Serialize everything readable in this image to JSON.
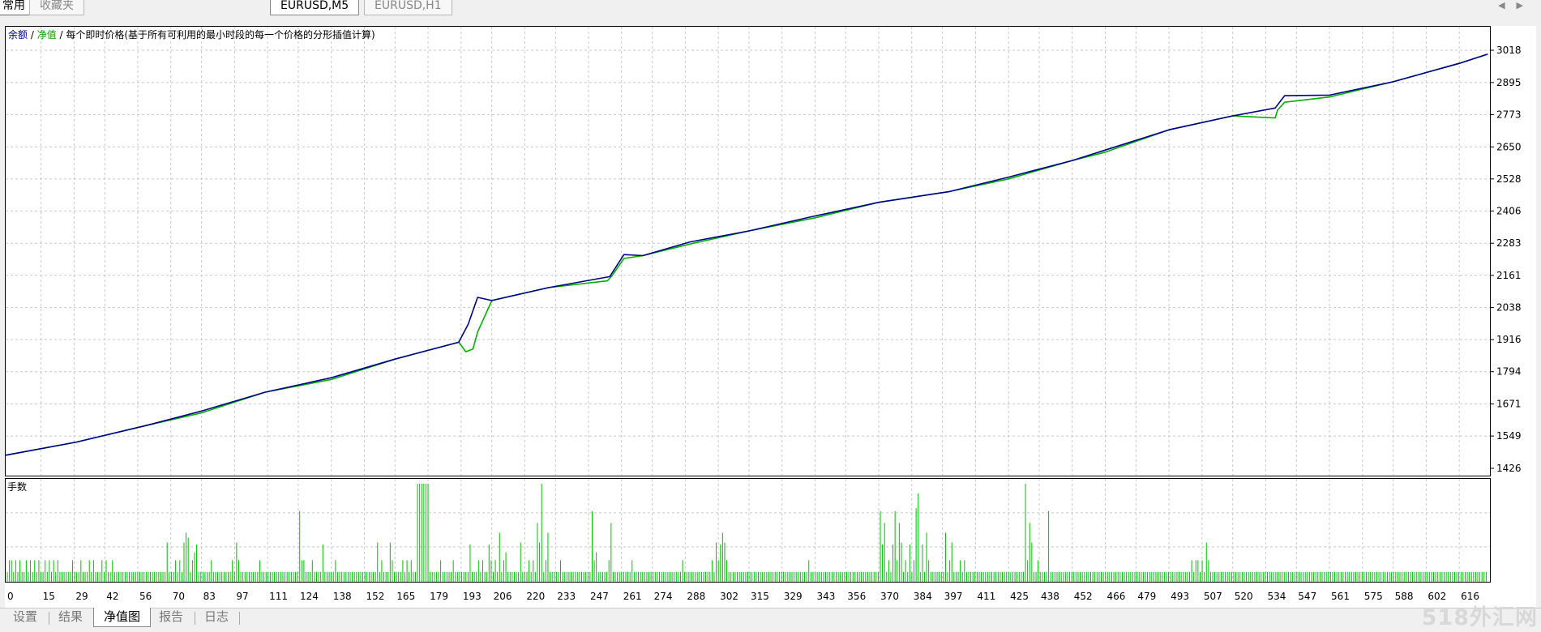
{
  "top_tabs": [
    {
      "label": "常用",
      "active": true
    },
    {
      "label": "收藏夹",
      "active": false
    }
  ],
  "symbol_tabs": [
    {
      "label": "EURUSD,M5",
      "active": true
    },
    {
      "label": "EURUSD,H1",
      "active": false
    }
  ],
  "legend": {
    "balance": "余额",
    "sep1": " / ",
    "equity": "净值",
    "sep2": " / ",
    "desc": "每个即时价格(基于所有可利用的最小时段的每一个价格的分形插值计算)"
  },
  "volume_label": "手数",
  "bottom_tabs": [
    {
      "label": "设置",
      "active": false
    },
    {
      "label": "结果",
      "active": false
    },
    {
      "label": "净值图",
      "active": true
    },
    {
      "label": "报告",
      "active": false
    },
    {
      "label": "日志",
      "active": false
    }
  ],
  "watermark": "518外汇网",
  "chart_data": [
    {
      "type": "line",
      "y_ticks": [
        3018,
        2895,
        2773,
        2650,
        2528,
        2406,
        2283,
        2161,
        2038,
        1916,
        1794,
        1671,
        1549,
        1426
      ],
      "ylim": [
        1426,
        3018
      ],
      "xlim": [
        0,
        629
      ],
      "x_ticks": [
        0,
        15,
        29,
        42,
        56,
        70,
        83,
        97,
        111,
        124,
        138,
        152,
        165,
        179,
        193,
        206,
        220,
        233,
        247,
        261,
        274,
        288,
        302,
        315,
        329,
        343,
        356,
        370,
        384,
        397,
        411,
        425,
        438,
        452,
        466,
        479,
        493,
        507,
        520,
        534,
        547,
        561,
        575,
        588,
        602,
        616
      ],
      "grid": true,
      "series": [
        {
          "name": "余额",
          "color": "#00008b",
          "x": [
            0,
            30,
            60,
            83,
            110,
            138,
            165,
            192,
            196,
            200,
            206,
            230,
            256,
            262,
            270,
            290,
            315,
            343,
            370,
            400,
            425,
            452,
            466,
            493,
            520,
            538,
            542,
            561,
            588,
            616,
            628
          ],
          "y": [
            1476,
            1526,
            1590,
            1644,
            1716,
            1771,
            1842,
            1906,
            1975,
            2077,
            2065,
            2114,
            2156,
            2240,
            2236,
            2288,
            2330,
            2387,
            2439,
            2480,
            2535,
            2598,
            2638,
            2715,
            2768,
            2798,
            2845,
            2847,
            2898,
            2968,
            3003
          ]
        },
        {
          "name": "净值",
          "color": "#00b000",
          "x": [
            0,
            30,
            60,
            83,
            110,
            138,
            165,
            192,
            195,
            198,
            200,
            206,
            230,
            255,
            257,
            262,
            270,
            290,
            315,
            343,
            370,
            400,
            425,
            452,
            466,
            493,
            520,
            538,
            539,
            542,
            561,
            588,
            616,
            628
          ],
          "y": [
            1476,
            1526,
            1590,
            1637,
            1716,
            1764,
            1842,
            1906,
            1870,
            1880,
            1945,
            2065,
            2114,
            2140,
            2160,
            2225,
            2236,
            2280,
            2330,
            2380,
            2439,
            2480,
            2528,
            2598,
            2630,
            2715,
            2768,
            2760,
            2790,
            2820,
            2840,
            2898,
            2968,
            3003
          ]
        }
      ]
    },
    {
      "type": "bar",
      "name": "手数",
      "color": "#00c000",
      "xlim": [
        0,
        629
      ],
      "heights_pct": [
        10,
        22,
        22,
        10,
        22,
        10,
        22,
        10,
        10,
        22,
        10,
        22,
        10,
        22,
        10,
        22,
        10,
        10,
        22,
        10,
        22,
        10,
        22,
        10,
        22,
        10,
        10,
        10,
        10,
        10,
        10,
        22,
        10,
        10,
        10,
        22,
        10,
        10,
        10,
        22,
        10,
        22,
        10,
        10,
        10,
        22,
        10,
        22,
        10,
        10,
        22,
        10,
        10,
        10,
        10,
        10,
        10,
        10,
        10,
        10,
        10,
        10,
        10,
        10,
        10,
        10,
        10,
        10,
        10,
        10,
        10,
        10,
        10,
        10,
        10,
        10,
        40,
        10,
        10,
        10,
        22,
        10,
        22,
        10,
        40,
        50,
        45,
        10,
        22,
        30,
        38,
        10,
        10,
        10,
        10,
        10,
        10,
        22,
        10,
        10,
        10,
        10,
        10,
        10,
        10,
        10,
        10,
        22,
        10,
        40,
        22,
        10,
        10,
        10,
        10,
        10,
        10,
        10,
        10,
        10,
        22,
        10,
        10,
        10,
        10,
        10,
        10,
        10,
        10,
        10,
        10,
        10,
        10,
        10,
        10,
        10,
        10,
        10,
        10,
        72,
        22,
        22,
        10,
        10,
        10,
        22,
        10,
        10,
        10,
        10,
        38,
        10,
        10,
        10,
        10,
        10,
        22,
        10,
        10,
        10,
        10,
        10,
        10,
        10,
        10,
        10,
        10,
        10,
        10,
        10,
        10,
        10,
        10,
        10,
        10,
        10,
        40,
        10,
        22,
        10,
        10,
        10,
        40,
        22,
        10,
        10,
        10,
        10,
        22,
        10,
        22,
        10,
        22,
        10,
        10,
        100,
        100,
        100,
        100,
        100,
        100,
        10,
        10,
        10,
        10,
        10,
        22,
        10,
        10,
        10,
        10,
        10,
        22,
        10,
        10,
        10,
        10,
        10,
        10,
        10,
        38,
        10,
        10,
        10,
        22,
        10,
        22,
        10,
        10,
        38,
        22,
        10,
        22,
        10,
        50,
        10,
        22,
        30,
        10,
        10,
        10,
        10,
        10,
        10,
        40,
        10,
        10,
        10,
        22,
        10,
        22,
        10,
        60,
        40,
        100,
        10,
        22,
        50,
        10,
        10,
        10,
        10,
        10,
        22,
        10,
        10,
        10,
        10,
        10,
        10,
        10,
        10,
        10,
        10,
        10,
        10,
        10,
        10,
        72,
        22,
        30,
        10,
        10,
        10,
        10,
        10,
        22,
        60,
        10,
        10,
        10,
        10,
        10,
        10,
        10,
        10,
        10,
        22,
        10,
        10,
        10,
        10,
        10,
        10,
        10,
        10,
        10,
        10,
        10,
        10,
        10,
        10,
        10,
        10,
        10,
        10,
        10,
        10,
        10,
        10,
        10,
        22,
        10,
        10,
        10,
        10,
        10,
        10,
        10,
        10,
        10,
        10,
        10,
        10,
        10,
        22,
        10,
        40,
        22,
        38,
        50,
        40,
        22,
        10,
        10,
        10,
        10,
        10,
        10,
        10,
        10,
        10,
        10,
        10,
        10,
        10,
        10,
        10,
        10,
        10,
        10,
        10,
        10,
        10,
        10,
        10,
        10,
        10,
        10,
        10,
        10,
        10,
        10,
        10,
        10,
        10,
        10,
        10,
        10,
        10,
        10,
        22,
        10,
        10,
        10,
        10,
        10,
        10,
        10,
        10,
        10,
        10,
        10,
        10,
        10,
        10,
        10,
        10,
        10,
        10,
        10,
        10,
        10,
        10,
        10,
        10,
        10,
        10,
        10,
        10,
        10,
        10,
        10,
        10,
        10,
        72,
        38,
        60,
        10,
        22,
        10,
        38,
        72,
        22,
        60,
        40,
        10,
        22,
        10,
        38,
        10,
        22,
        75,
        90,
        10,
        38,
        10,
        50,
        22,
        10,
        10,
        10,
        10,
        10,
        10,
        10,
        50,
        10,
        22,
        40,
        10,
        10,
        10,
        22,
        10,
        22,
        10,
        10,
        10,
        10,
        10,
        10,
        10,
        10,
        10,
        10,
        10,
        10,
        10,
        10,
        10,
        10,
        10,
        10,
        10,
        10,
        10,
        10,
        10,
        10,
        10,
        10,
        10,
        10,
        100,
        22,
        60,
        40,
        10,
        10,
        22,
        10,
        10,
        10,
        10,
        72,
        10,
        10,
        10,
        10,
        10,
        10,
        10,
        10,
        10,
        10,
        10,
        10,
        10,
        10,
        10,
        10,
        10,
        10,
        10,
        10,
        10,
        10,
        10,
        10,
        10,
        10,
        10,
        10,
        10,
        10,
        10,
        10,
        10,
        10,
        10,
        10,
        10,
        10,
        10,
        10,
        10,
        10,
        10,
        10,
        10,
        10,
        10,
        10,
        10,
        10,
        10,
        10,
        10,
        10,
        10,
        10,
        10,
        10,
        10,
        10,
        10,
        10,
        10,
        10,
        10,
        10,
        10,
        22,
        10,
        22,
        22,
        10,
        22,
        10,
        40,
        22,
        10,
        10,
        10,
        10,
        10,
        10,
        10,
        10,
        10,
        10,
        10,
        10,
        10,
        10,
        10,
        10,
        10,
        10,
        10,
        10,
        10,
        10,
        10,
        10,
        10,
        10,
        10,
        10,
        10,
        10,
        10,
        10,
        10,
        10,
        10,
        10,
        10,
        10,
        10,
        10,
        10,
        10,
        10,
        10,
        10,
        10,
        10,
        10,
        10,
        10,
        10,
        10,
        10,
        10,
        10,
        10,
        10,
        10,
        10,
        10,
        10,
        10,
        10,
        10,
        10,
        10,
        10,
        10,
        10,
        10,
        10,
        10,
        10,
        10,
        10,
        10,
        10,
        10,
        10,
        10,
        10,
        10,
        10,
        10,
        10,
        10,
        10,
        10,
        10,
        10,
        10,
        10,
        10,
        10,
        10,
        10,
        10,
        10,
        10,
        10,
        10,
        10,
        10,
        10,
        10,
        10,
        10,
        10,
        10,
        10,
        10,
        10,
        10,
        10,
        10,
        10,
        10,
        10,
        10,
        10,
        10,
        10,
        10,
        10,
        10,
        10,
        10,
        10,
        10,
        10,
        10,
        10
      ]
    }
  ]
}
